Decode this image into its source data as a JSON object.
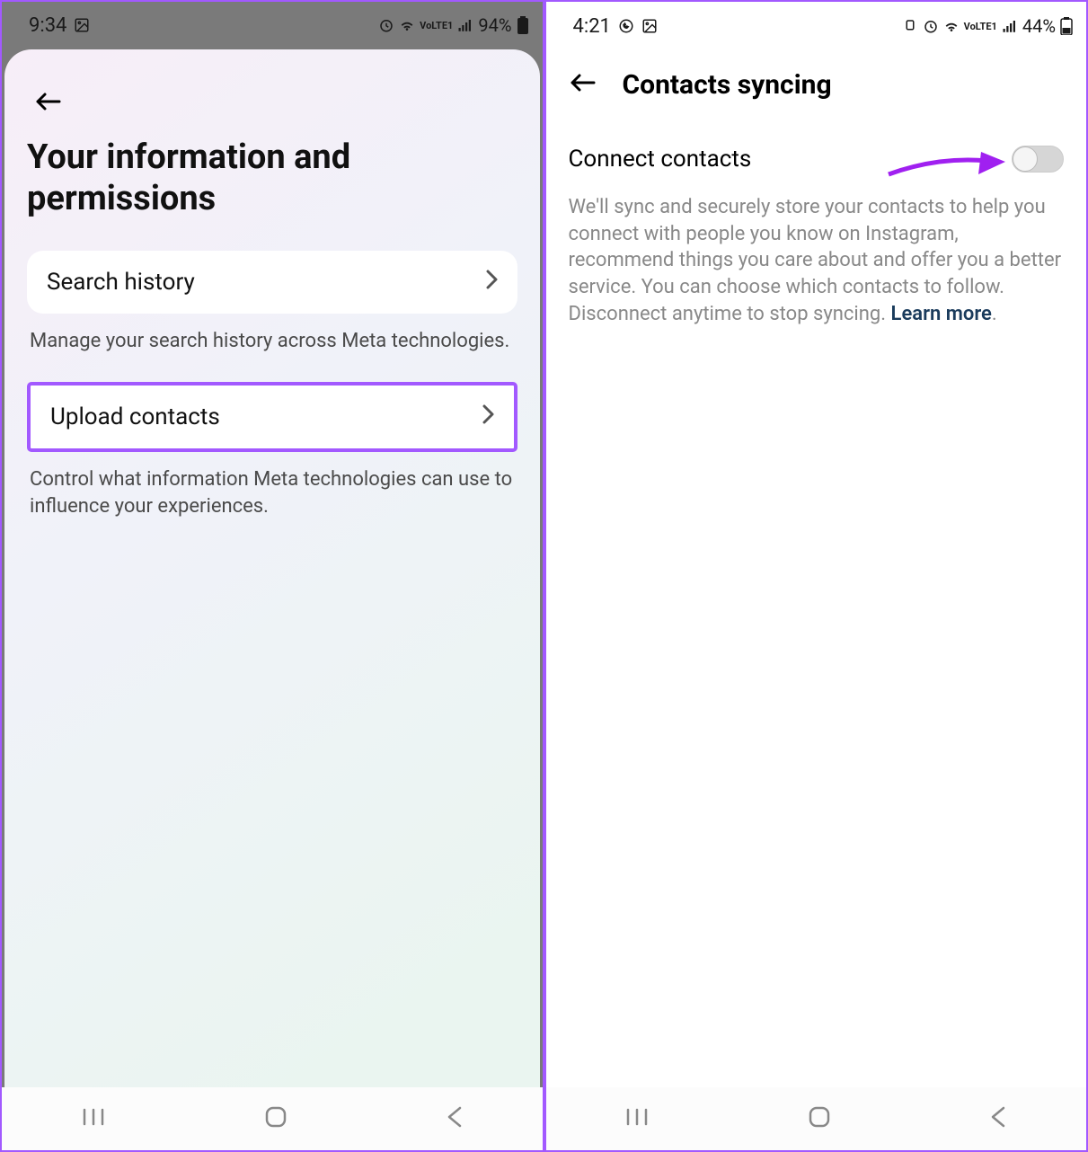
{
  "left": {
    "status": {
      "time": "9:34",
      "battery_pct": "94%"
    },
    "page_title": "Your information and permissions",
    "items": [
      {
        "label": "Search history",
        "desc": "Manage your search history across Meta technologies."
      },
      {
        "label": "Upload contacts",
        "desc": "Control what information Meta technologies can use to influence your experiences."
      }
    ]
  },
  "right": {
    "status": {
      "time": "4:21",
      "battery_pct": "44%"
    },
    "header_title": "Contacts syncing",
    "toggle_label": "Connect contacts",
    "description": "We'll sync and securely store your contacts to help you connect with people you know on Instagram, recommend things you care about and offer you a better service. You can choose which contacts to follow. Disconnect anytime to stop syncing. ",
    "learn_more": "Learn more",
    "period": "."
  },
  "highlight_color": "#a259ff"
}
